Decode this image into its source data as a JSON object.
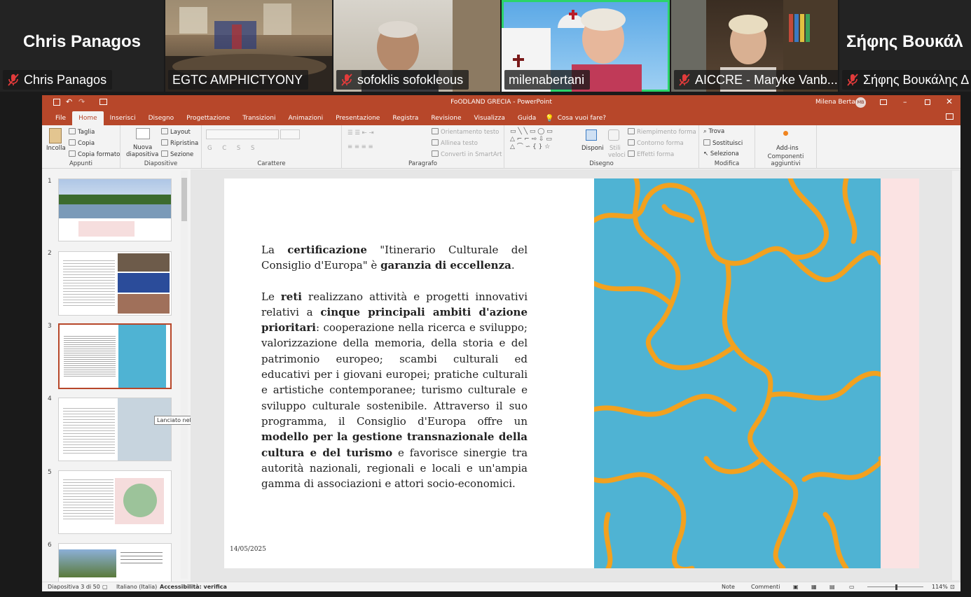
{
  "participants": [
    {
      "name": "Chris Panagos",
      "big_name": "Chris Panagos",
      "muted": true
    },
    {
      "name": "EGTC AMPHICTYONY",
      "muted": false
    },
    {
      "name": "sofoklis sofokleous",
      "muted": true
    },
    {
      "name": "milenabertani",
      "muted": false,
      "active": true
    },
    {
      "name": "AICCRE - Maryke Vanb...",
      "muted": true
    },
    {
      "name": "Σήφης Βουκάλης Δ",
      "big_name": "Σήφης Βουκάλ",
      "muted": true
    }
  ],
  "window": {
    "title": "FoODLAND GRECIA  -  PowerPoint",
    "user": "Milena Bertani",
    "user_initials": "MB",
    "tell_me": "Cosa vuoi fare?"
  },
  "tabs": [
    "File",
    "Home",
    "Inserisci",
    "Disegno",
    "Progettazione",
    "Transizioni",
    "Animazioni",
    "Presentazione",
    "Registra",
    "Revisione",
    "Visualizza",
    "Guida"
  ],
  "selected_tab": "Home",
  "ribbon": {
    "appunti": {
      "label": "Appunti",
      "paste": "Incolla",
      "cut": "Taglia",
      "copy": "Copia",
      "format": "Copia formato"
    },
    "diapositive": {
      "label": "Diapositive",
      "new": "Nuova",
      "new2": "diapositiva",
      "layout": "Layout",
      "reset": "Ripristina",
      "section": "Sezione"
    },
    "carattere": {
      "label": "Carattere"
    },
    "paragrafo": {
      "label": "Paragrafo",
      "orient": "Orientamento testo",
      "align": "Allinea testo",
      "smartart": "Converti in SmartArt"
    },
    "disegno": {
      "label": "Disegno",
      "arrange": "Disponi",
      "styles": "Stili",
      "styles2": "veloci",
      "fill": "Riempimento forma",
      "outline": "Contorno forma",
      "effects": "Effetti forma"
    },
    "modifica": {
      "label": "Modifica",
      "find": "Trova",
      "replace": "Sostituisci",
      "select": "Seleziona"
    },
    "addins": {
      "label": "Componenti aggiuntivi",
      "button": "Add-ins"
    }
  },
  "thumbnails": [
    "1",
    "2",
    "3",
    "4",
    "5",
    "6"
  ],
  "selected_slide": "3",
  "tooltip": "Lanciato nel 1987 con la Dichia...",
  "slide": {
    "p1": [
      {
        "t": "La "
      },
      {
        "t": "certificazione",
        "b": true
      },
      {
        "t": " \"Itinerario Culturale del Consiglio d'Europa\" è "
      },
      {
        "t": "garanzia di eccellenza",
        "b": true
      },
      {
        "t": "."
      }
    ],
    "p2": [
      {
        "t": "Le "
      },
      {
        "t": "reti",
        "b": true
      },
      {
        "t": " realizzano attività e progetti innovativi relativi a "
      },
      {
        "t": "cinque principali ambiti d'azione prioritari",
        "b": true
      },
      {
        "t": ": cooperazione nella ricerca e sviluppo; valorizzazione della memoria, della storia e del patrimonio europeo; scambi culturali ed educativi per i giovani europei; pratiche culturali e artistiche contemporanee; turismo culturale e sviluppo culturale sostenibile. Attraverso il suo programma, il Consiglio d'Europa offre un "
      },
      {
        "t": "modello per la gestione transnazionale della cultura e del turismo",
        "b": true
      },
      {
        "t": " e favorisce sinergie tra autorità nazionali, regionali e locali e un'ampia gamma di associazioni e attori socio-economici."
      }
    ],
    "date": "14/05/2025"
  },
  "status": {
    "slide_count": "Diapositiva 3 di 50",
    "language": "Italiano (Italia)",
    "accessibility": "Accessibilità: verifica",
    "notes": "Note",
    "comments": "Commenti",
    "zoom": "114%"
  },
  "colors": {
    "accent": "#b7472a",
    "active_speaker": "#2bd46a",
    "map_sea": "#4fb3d3",
    "map_lines": "#f2a11f"
  }
}
